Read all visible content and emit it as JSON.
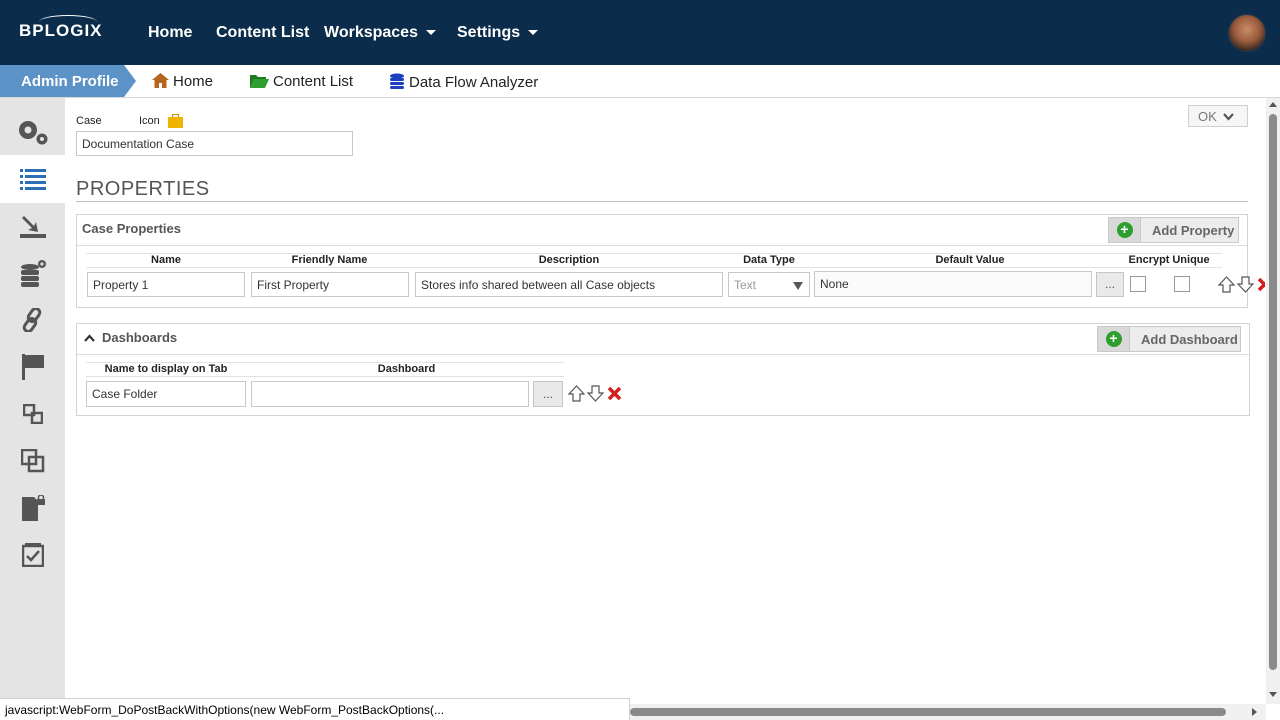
{
  "topnav": {
    "logo": "BPLOGIX",
    "items": [
      {
        "label": "Home",
        "has_caret": false
      },
      {
        "label": "Content List",
        "has_caret": false
      },
      {
        "label": "Workspaces",
        "has_caret": true
      },
      {
        "label": "Settings",
        "has_caret": true
      }
    ],
    "avatar_icon": "user-avatar"
  },
  "breadcrumb": {
    "current": "Admin Profile",
    "links": [
      {
        "label": "Home",
        "icon": "home-icon"
      },
      {
        "label": "Content List",
        "icon": "folder-icon"
      },
      {
        "label": "Data Flow Analyzer",
        "icon": "database-icon"
      }
    ]
  },
  "sidebar": {
    "items": [
      {
        "icon": "settings-gears-icon",
        "active": false
      },
      {
        "icon": "list-icon",
        "active": true
      },
      {
        "icon": "import-icon",
        "active": false
      },
      {
        "icon": "database-add-icon",
        "active": false
      },
      {
        "icon": "link-icon",
        "active": false
      },
      {
        "icon": "flag-icon",
        "active": false
      },
      {
        "icon": "relationship-icon",
        "active": false
      },
      {
        "icon": "copy-icon",
        "active": false
      },
      {
        "icon": "locked-document-icon",
        "active": false
      },
      {
        "icon": "checklist-icon",
        "active": false
      }
    ]
  },
  "form": {
    "case_label": "Case",
    "icon_label": "Icon",
    "case_value": "Documentation Case",
    "ok_label": "OK"
  },
  "properties": {
    "title": "PROPERTIES",
    "case_properties": {
      "title": "Case Properties",
      "add_label": "Add Property",
      "columns": [
        "Name",
        "Friendly Name",
        "Description",
        "Data Type",
        "Default Value",
        "Encrypt",
        "Unique"
      ],
      "rows": [
        {
          "name": "Property 1",
          "friendly_name": "First Property",
          "description": "Stores info shared between all Case objects",
          "data_type": "Text",
          "default_value": "None",
          "encrypt": false,
          "unique": false
        }
      ]
    },
    "dashboards": {
      "title": "Dashboards",
      "add_label": "Add Dashboard",
      "columns": [
        "Name to display on Tab",
        "Dashboard"
      ],
      "rows": [
        {
          "name": "Case Folder",
          "dashboard": ""
        }
      ]
    },
    "ellipsis": "..."
  },
  "status_bar": "javascript:WebForm_DoPostBackWithOptions(new WebForm_PostBackOptions(...",
  "colors": {
    "topbar": "#0b2c4b",
    "breadcrumb_active": "#5b93c6",
    "sidebar": "#e4e4e4",
    "add_green": "#2e9e2e",
    "delete_red": "#d41d1d"
  }
}
